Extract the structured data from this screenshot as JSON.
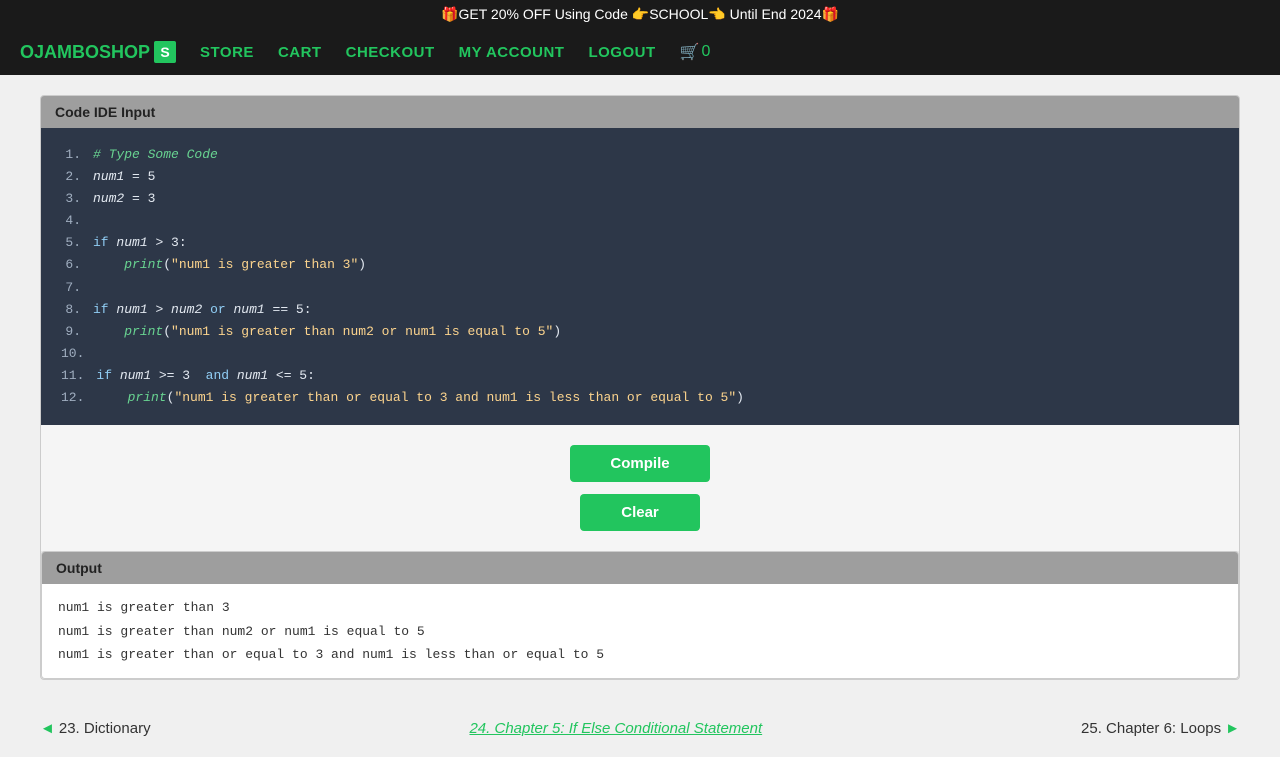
{
  "announcement": {
    "text": "🎁GET 20% OFF Using Code 👉SCHOOL👈 Until End 2024🎁"
  },
  "nav": {
    "brand": "OJAMBOSHOP",
    "brand_s": "S",
    "links": [
      "STORE",
      "CART",
      "CHECKOUT",
      "MY ACCOUNT",
      "LOGOUT"
    ],
    "cart_count": "0"
  },
  "code_panel": {
    "header": "Code IDE Input",
    "lines": [
      {
        "num": "1.",
        "content": "# Type Some Code",
        "type": "comment"
      },
      {
        "num": "2.",
        "content": "num1 = 5",
        "type": "code"
      },
      {
        "num": "3.",
        "content": "num2 = 3",
        "type": "code"
      },
      {
        "num": "4.",
        "content": "",
        "type": "code"
      },
      {
        "num": "5.",
        "content": "if num1 > 3:",
        "type": "code"
      },
      {
        "num": "6.",
        "content": "    print(\"num1 is greater than 3\")",
        "type": "code"
      },
      {
        "num": "7.",
        "content": "",
        "type": "code"
      },
      {
        "num": "8.",
        "content": "if num1 > num2 or num1 == 5:",
        "type": "code"
      },
      {
        "num": "9.",
        "content": "    print(\"num1 is greater than num2 or num1 is equal to 5\")",
        "type": "code"
      },
      {
        "num": "10.",
        "content": "",
        "type": "code"
      },
      {
        "num": "11.",
        "content": "if num1 >= 3  and num1 <= 5:",
        "type": "code"
      },
      {
        "num": "12.",
        "content": "    print(\"num1 is greater than or equal to 3 and num1 is less than or equal to 5\")",
        "type": "code"
      }
    ]
  },
  "buttons": {
    "compile": "Compile",
    "clear": "Clear"
  },
  "output_panel": {
    "header": "Output",
    "lines": [
      "num1 is greater than 3",
      "num1 is greater than num2 or num1 is equal to 5",
      "num1 is greater than or equal to 3 and num1 is less than or equal to 5"
    ]
  },
  "bottom_nav": {
    "prev_num": "23.",
    "prev_label": "Dictionary",
    "current_num": "24.",
    "current_label": "Chapter 5: If Else Conditional Statement",
    "next_num": "25.",
    "next_label": "Chapter 6: Loops"
  }
}
